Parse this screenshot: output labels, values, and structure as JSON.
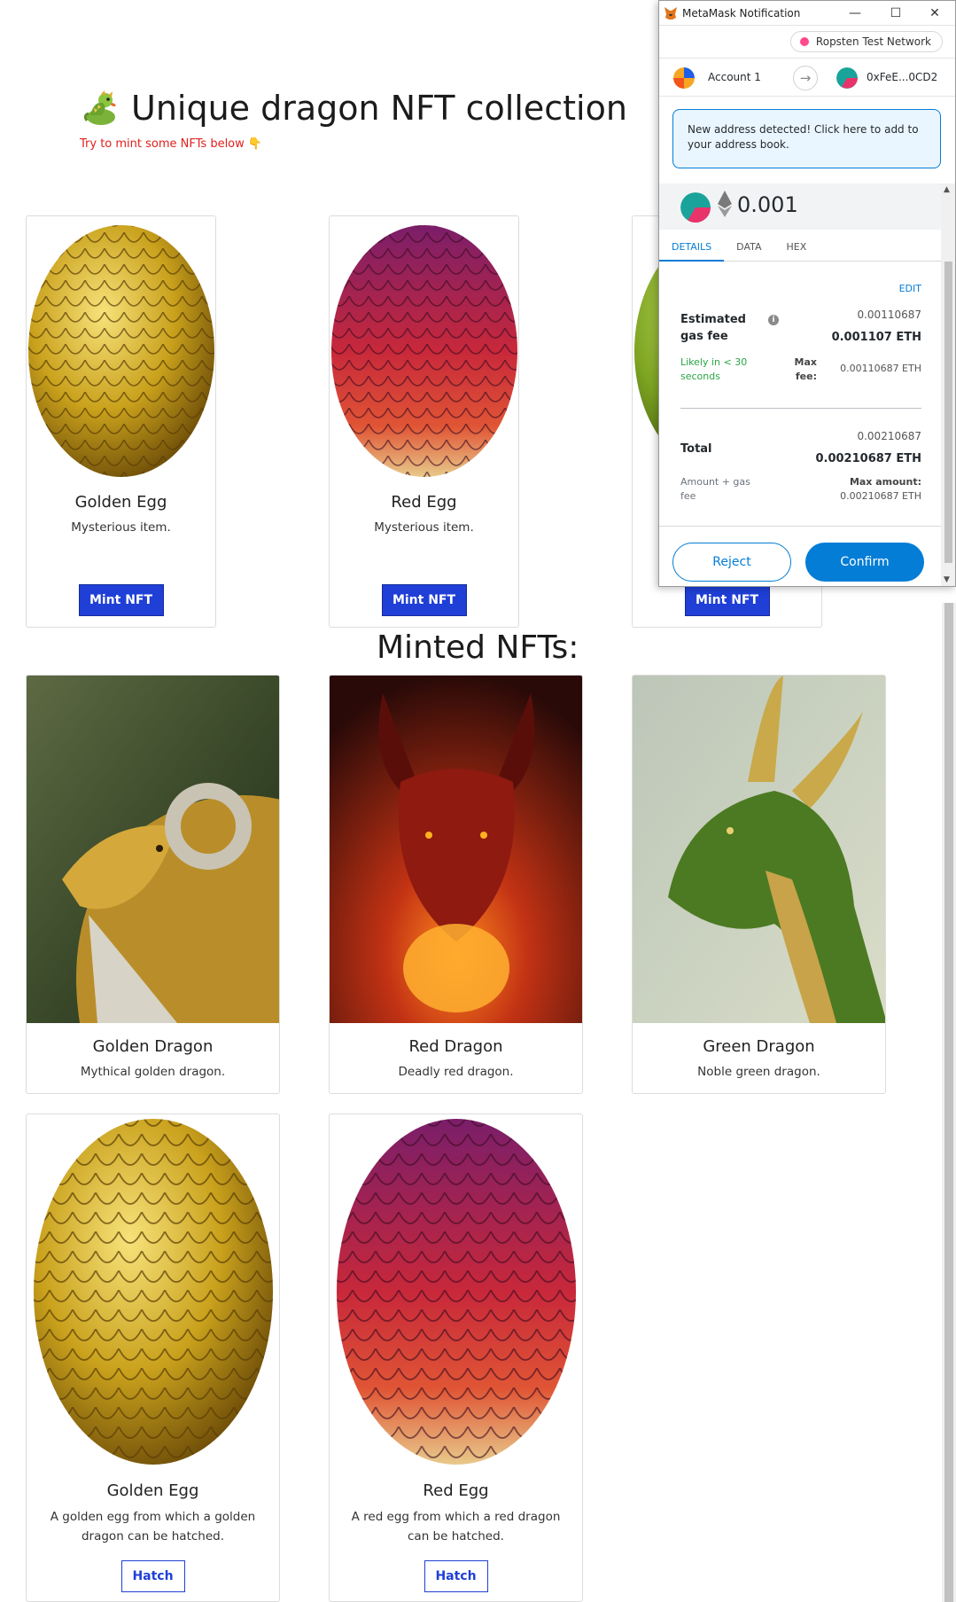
{
  "header": {
    "title": "Unique dragon NFT collection",
    "title_icon": "dragon-icon",
    "subtitle": "Try to mint some NFTs below 👇"
  },
  "mint_cards": [
    {
      "name": "Golden Egg",
      "description": "Mysterious item.",
      "button": "Mint NFT"
    },
    {
      "name": "Red Egg",
      "description": "Mysterious item.",
      "button": "Mint NFT"
    },
    {
      "name": "",
      "description": "",
      "button": "Mint NFT"
    }
  ],
  "minted_title": "Minted NFTs:",
  "minted_dragons": [
    {
      "name": "Golden Dragon",
      "description": "Mythical golden dragon."
    },
    {
      "name": "Red Dragon",
      "description": "Deadly red dragon."
    },
    {
      "name": "Green Dragon",
      "description": "Noble green dragon."
    }
  ],
  "minted_eggs": [
    {
      "name": "Golden Egg",
      "description": "A golden egg from which a golden dragon can be hatched.",
      "button": "Hatch"
    },
    {
      "name": "Red Egg",
      "description": "A red egg from which a red dragon can be hatched.",
      "button": "Hatch"
    }
  ],
  "colors": {
    "mint_button": "#1f3fd6",
    "subtitle_red": "#e0201d",
    "metamask_blue": "#037dd6",
    "likely_green": "#28a745",
    "network_dot": "#ff4a8d"
  },
  "metamask": {
    "window_title": "MetaMask Notification",
    "network": "Ropsten Test Network",
    "from_account": "Account 1",
    "to_address": "0xFeE...0CD2",
    "notice": "New address detected! Click here to add to your address book.",
    "amount": "0.001",
    "tabs": [
      "DETAILS",
      "DATA",
      "HEX"
    ],
    "active_tab": "DETAILS",
    "edit_label": "EDIT",
    "gas_label": "Estimated gas fee",
    "gas_value_light": "0.00110687",
    "gas_value_bold": "0.001107 ETH",
    "likely_text": "Likely in < 30 seconds",
    "max_fee_label": "Max fee:",
    "max_fee_value": "0.00110687 ETH",
    "total_label": "Total",
    "total_value_light": "0.00210687",
    "total_value_bold": "0.00210687 ETH",
    "amount_gas_label": "Amount + gas fee",
    "max_amount_label": "Max amount:",
    "max_amount_value": "0.00210687 ETH",
    "reject_label": "Reject",
    "confirm_label": "Confirm"
  }
}
